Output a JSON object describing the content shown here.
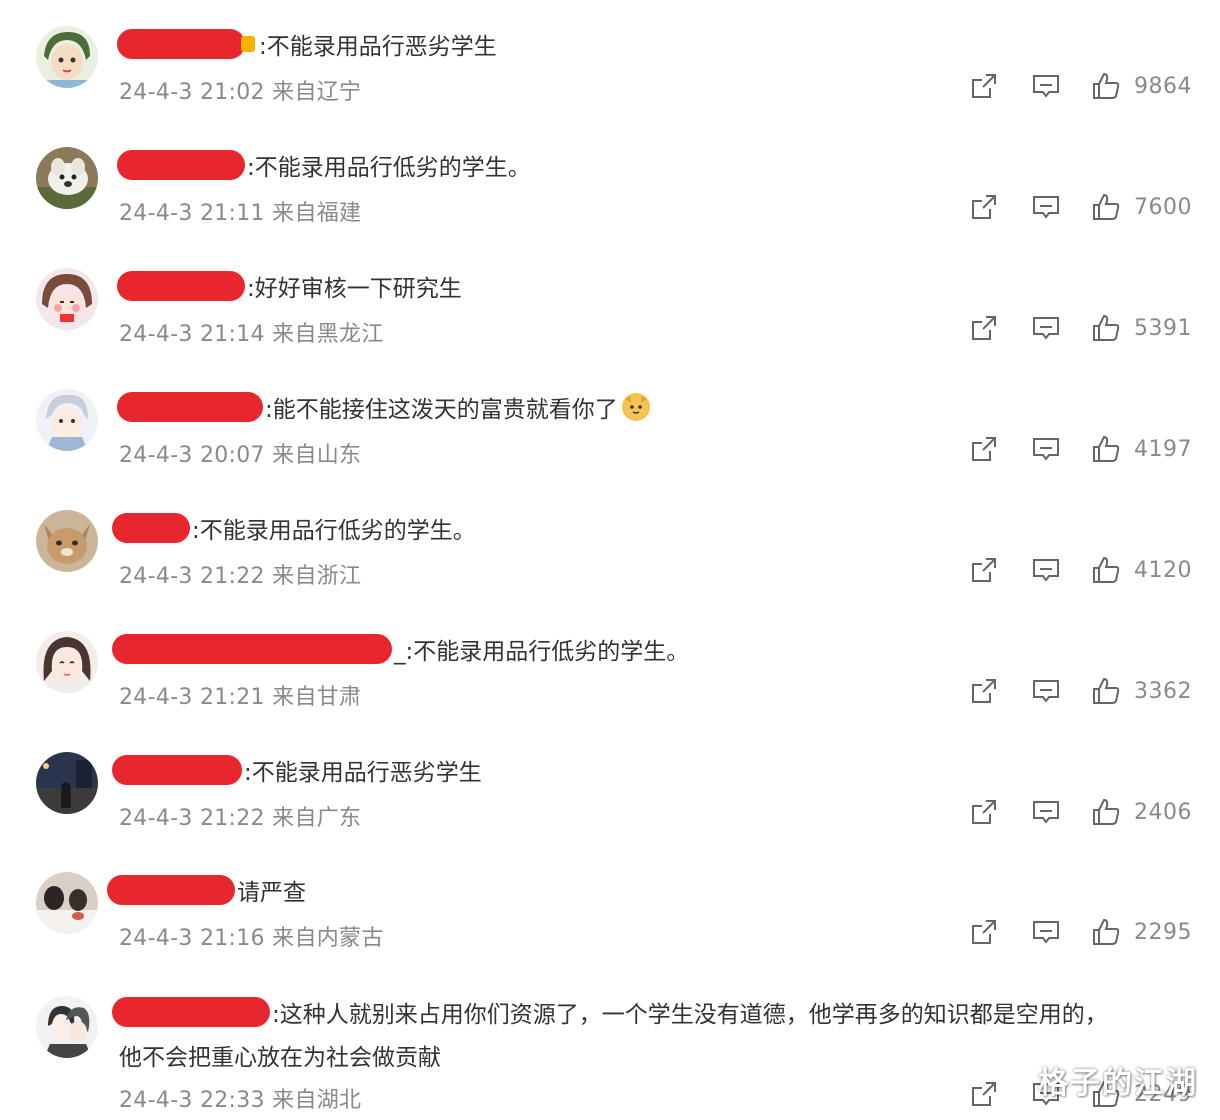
{
  "comments": [
    {
      "text": ":不能录用品行恶劣学生",
      "meta": "24-4-3 21:02 来自辽宁",
      "likes": "9864",
      "avatar": "avatar-cartoon-girl-green"
    },
    {
      "text": ":不能录用品行低劣的学生。",
      "meta": "24-4-3 21:11 来自福建",
      "likes": "7600",
      "avatar": "avatar-white-dog"
    },
    {
      "text": ":好好审核一下研究生",
      "meta": "24-4-3 21:14 来自黑龙江",
      "likes": "5391",
      "avatar": "avatar-cartoon-girl-pink"
    },
    {
      "text": ":能不能接住这泼天的富贵就看你了",
      "meta": "24-4-3 20:07 来自山东",
      "likes": "4197",
      "avatar": "avatar-anime-boy"
    },
    {
      "text": ":不能录用品行低劣的学生。",
      "meta": "24-4-3 21:22 来自浙江",
      "likes": "4120",
      "avatar": "avatar-cat"
    },
    {
      "text": "_:不能录用品行低劣的学生。",
      "meta": "24-4-3 21:21 来自甘肃",
      "likes": "3362",
      "avatar": "avatar-anime-girl"
    },
    {
      "text": ":不能录用品行恶劣学生",
      "meta": "24-4-3 21:22 来自广东",
      "likes": "2406",
      "avatar": "avatar-night-street"
    },
    {
      "text": "请严查",
      "meta": "24-4-3 21:16 来自内蒙古",
      "likes": "2295",
      "avatar": "avatar-photo-people"
    },
    {
      "text": ":这种人就别来占用你们资源了，一个学生没有道德，他学再多的知识都是空用的，",
      "text2": "他不会把重心放在为社会做贡献",
      "meta": "24-4-3 22:33 来自湖北",
      "likes": "2249",
      "avatar": "avatar-couple-sketch"
    }
  ],
  "watermark": "格子的江湖",
  "colors": {
    "redaction": "#e8262d",
    "meta": "#8a8a8a",
    "text": "#333333"
  },
  "icons": {
    "share": "share-icon",
    "reply": "comment-icon",
    "like": "thumbs-up-icon"
  }
}
